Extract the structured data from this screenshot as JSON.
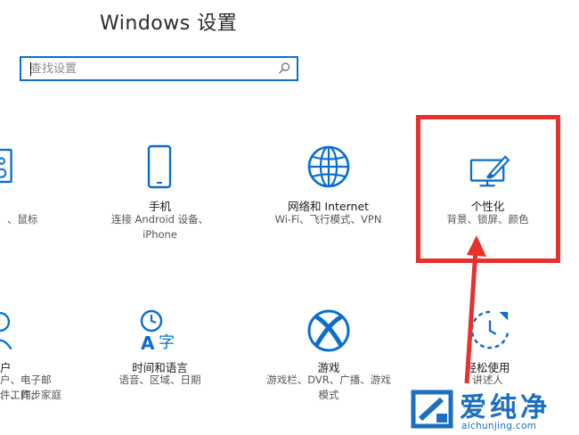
{
  "window_title": "Windows 设置",
  "search": {
    "placeholder": "查找设置"
  },
  "tiles": [
    {
      "name": "",
      "desc": [
        "、鼠标"
      ]
    },
    {
      "name": "手机",
      "desc": [
        "连接 Android 设备、",
        "iPhone"
      ]
    },
    {
      "name": "网络和 Internet",
      "desc": [
        "Wi-Fi、飞行模式、VPN"
      ]
    },
    {
      "name": "个性化",
      "desc": [
        "背景、锁屏、颜色"
      ]
    },
    {
      "name": "户",
      "desc": [
        "户、电子邮件、同步",
        "、工作、家庭"
      ]
    },
    {
      "name": "时间和语言",
      "desc": [
        "语音、区域、日期"
      ]
    },
    {
      "name": "游戏",
      "desc": [
        "游戏栏、DVR、广播、游戏",
        "模式"
      ]
    },
    {
      "name": "轻松使用",
      "desc": [
        "讲述人"
      ]
    }
  ],
  "watermark": {
    "brand": "爱纯净",
    "url": "aichunjing.com"
  },
  "colors": {
    "accent": "#0a6fcc",
    "highlight": "#e8302c",
    "brand": "#1b6fc0"
  }
}
